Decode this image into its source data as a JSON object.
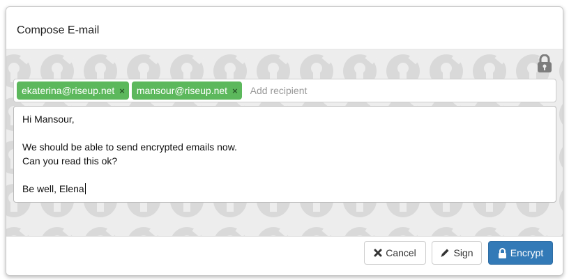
{
  "dialog": {
    "title": "Compose E-mail"
  },
  "recipients": {
    "tags": [
      {
        "email": "ekaterina@riseup.net",
        "remove": "×"
      },
      {
        "email": "mansour@riseup.net",
        "remove": "×"
      }
    ],
    "placeholder": "Add recipient"
  },
  "message": {
    "lines": [
      "Hi Mansour,",
      "",
      "We should be able to send encrypted emails now.",
      "Can you read this ok?",
      "",
      "Be well, Elena"
    ]
  },
  "footer": {
    "cancel_label": "Cancel",
    "sign_label": "Sign",
    "encrypt_label": "Encrypt"
  },
  "icons": {
    "lock": "lock-icon",
    "cancel": "close-icon",
    "sign": "pencil-icon",
    "encrypt": "lock-icon"
  },
  "colors": {
    "tag_green": "#5cb85c",
    "primary_blue": "#337ab7",
    "background_pattern": "#ededed"
  }
}
